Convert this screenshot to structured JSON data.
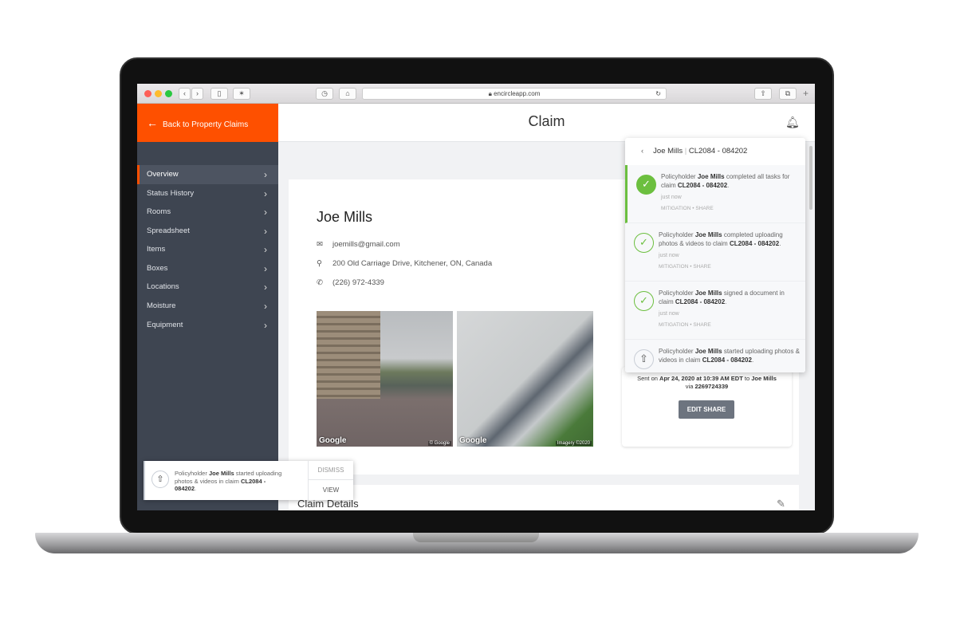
{
  "browser": {
    "url": "encircleapp.com"
  },
  "sidebar": {
    "back_label": "Back to Property Claims",
    "items": [
      {
        "label": "Overview",
        "active": true
      },
      {
        "label": "Status History"
      },
      {
        "label": "Rooms"
      },
      {
        "label": "Spreadsheet"
      },
      {
        "label": "Items"
      },
      {
        "label": "Boxes"
      },
      {
        "label": "Locations"
      },
      {
        "label": "Moisture"
      },
      {
        "label": "Equipment"
      }
    ]
  },
  "header": {
    "title": "Claim"
  },
  "claimant": {
    "name": "Joe Mills",
    "email": "joemills@gmail.com",
    "address": "200 Old Carriage Drive, Kitchener, ON, Canada",
    "phone": "(226) 972-4339"
  },
  "photos": [
    {
      "logo": "Google",
      "credit": "© Google"
    },
    {
      "logo": "Google",
      "credit": "Imagery ©2020"
    }
  ],
  "share": {
    "sent_prefix": "Sent on ",
    "sent_date": "Apr 24, 2020 at 10:39 AM EDT",
    "sent_to": " to ",
    "sent_name": "Joe Mills",
    "via": "via ",
    "via_number": "2269724339",
    "edit_label": "EDIT SHARE"
  },
  "details": {
    "title": "Claim Details"
  },
  "notifications": {
    "header_name": "Joe Mills",
    "header_sep": "|",
    "header_claim": "CL2084 - 084202",
    "items": [
      {
        "pre": "Policyholder ",
        "name": "Joe Mills",
        "mid": " completed all tasks for claim ",
        "claim": "CL2084 - 084202",
        "post": ".",
        "time": "just now",
        "tags": "MITIGATION • SHARE",
        "icon": "check-filled"
      },
      {
        "pre": "Policyholder ",
        "name": "Joe Mills",
        "mid": " completed uploading photos & videos to claim ",
        "claim": "CL2084 - 084202",
        "post": ".",
        "time": "just now",
        "tags": "MITIGATION • SHARE",
        "icon": "check-outline"
      },
      {
        "pre": "Policyholder ",
        "name": "Joe Mills",
        "mid": " signed a document in claim ",
        "claim": "CL2084 - 084202",
        "post": ".",
        "time": "just now",
        "tags": "MITIGATION • SHARE",
        "icon": "check-outline"
      },
      {
        "pre": "Policyholder ",
        "name": "Joe Mills",
        "mid": " started uploading photos & videos in claim ",
        "claim": "CL2084 - 084202",
        "post": ".",
        "icon": "upload"
      }
    ]
  },
  "toast": {
    "pre": "Policyholder ",
    "name": "Joe Mills",
    "mid": " started uploading photos & videos in claim ",
    "claim": "CL2084 - 084202",
    "post": ".",
    "dismiss": "DISMISS",
    "view": "VIEW"
  },
  "colors": {
    "accent": "#fe5000",
    "sidebar": "#3e4551",
    "success": "#6cbf3f"
  }
}
